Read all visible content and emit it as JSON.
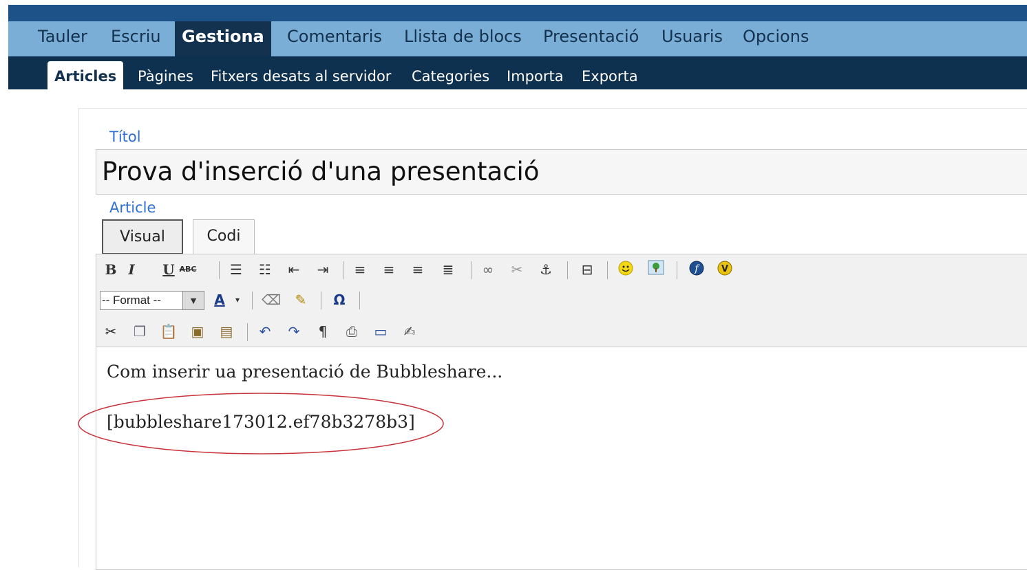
{
  "main_nav": [
    {
      "label": "Tauler",
      "active": false
    },
    {
      "label": "Escriu",
      "active": false
    },
    {
      "label": "Gestiona",
      "active": true
    },
    {
      "label": "Comentaris",
      "active": false
    },
    {
      "label": "Llista de blocs",
      "active": false
    },
    {
      "label": "Presentació",
      "active": false
    },
    {
      "label": "Usuaris",
      "active": false
    },
    {
      "label": "Opcions",
      "active": false
    }
  ],
  "sub_nav": [
    {
      "label": "Articles",
      "active": true
    },
    {
      "label": "Pàgines",
      "active": false
    },
    {
      "label": "Fitxers desats al servidor",
      "active": false
    },
    {
      "label": "Categories",
      "active": false
    },
    {
      "label": "Importa",
      "active": false
    },
    {
      "label": "Exporta",
      "active": false
    }
  ],
  "form": {
    "title_label": "Títol",
    "title_value": "Prova d'inserció d'una presentació",
    "article_label": "Article"
  },
  "editor_tabs": [
    {
      "label": "Visual",
      "active": true
    },
    {
      "label": "Codi",
      "active": false
    }
  ],
  "toolbar": {
    "format_select": "-- Format --",
    "row1_icons": [
      "bold-icon",
      "italic-icon",
      "underline-icon",
      "strikethrough-icon",
      "bullet-list-icon",
      "numbered-list-icon",
      "outdent-icon",
      "indent-icon",
      "align-left-icon",
      "align-center-icon",
      "align-right-icon",
      "align-justify-icon",
      "link-icon",
      "unlink-icon",
      "anchor-icon",
      "more-break-icon",
      "smiley-icon",
      "image-icon",
      "flash-icon",
      "video-icon"
    ],
    "row2_icons": [
      "text-color-icon",
      "remove-format-icon",
      "cleanup-icon",
      "special-char-icon"
    ],
    "row3_icons": [
      "cut-icon",
      "copy-icon",
      "paste-icon",
      "paste-text-icon",
      "paste-word-icon",
      "undo-icon",
      "redo-icon",
      "paragraph-icon",
      "print-icon",
      "fullscreen-icon",
      "edit-html-icon"
    ]
  },
  "editor_content": {
    "line1": "Com inserir ua presentació de Bubbleshare...",
    "line2": "[bubbleshare173012.ef78b3278b3]"
  },
  "colors": {
    "top_bar": "#1c5287",
    "main_nav_bg": "#7aaed6",
    "sub_nav_bg": "#0f3150",
    "label_blue": "#2e6fd3",
    "highlight_circle": "#c8323a"
  }
}
